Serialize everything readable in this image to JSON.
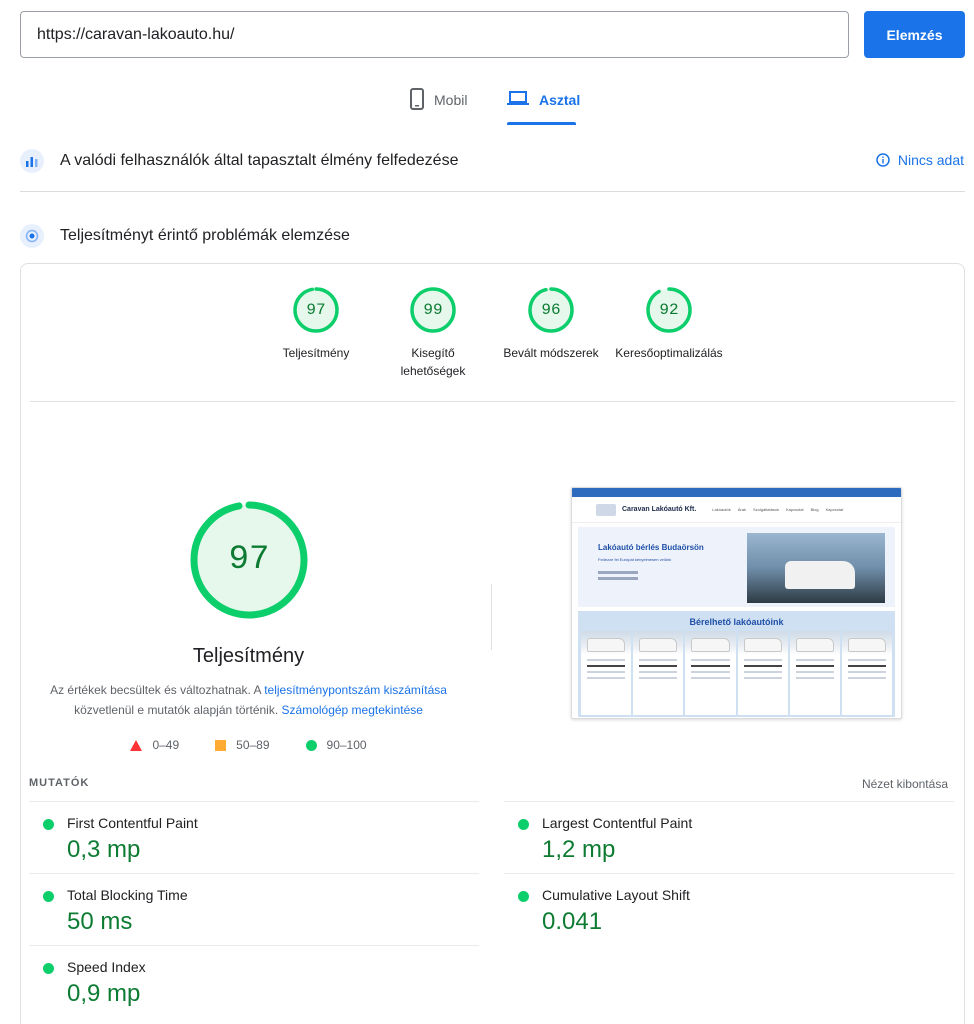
{
  "url_bar": {
    "value": "https://caravan-lakoauto.hu/",
    "button": "Elemzés"
  },
  "tabs": [
    {
      "label": "Mobil",
      "active": false
    },
    {
      "label": "Asztal",
      "active": true
    }
  ],
  "crux": {
    "title": "A valódi felhasználók által tapasztalt élmény felfedezése",
    "status": "Nincs adat"
  },
  "lighthouse": {
    "title": "Teljesítményt érintő problémák elemzése"
  },
  "categories": [
    {
      "score": "97",
      "score_value": 97,
      "label": "Teljesítmény"
    },
    {
      "score": "99",
      "score_value": 99,
      "label_line1": "Kisegítő",
      "label_line2": "lehetőségek"
    },
    {
      "score": "96",
      "score_value": 96,
      "label": "Bevált módszerek"
    },
    {
      "score": "92",
      "score_value": 92,
      "label": "Keresőoptimalizálás"
    }
  ],
  "performance": {
    "score": "97",
    "score_value": 97,
    "title": "Teljesítmény",
    "disclaimer_start": "Az értékek becsültek és változhatnak. A ",
    "disclaimer_link1": "teljesítménypontszám kiszámítása",
    "disclaimer_mid": " közvetlenül e mutatók alapján történik. ",
    "disclaimer_link2": "Számológép megtekintése"
  },
  "legend": [
    {
      "shape": "triangle",
      "label": "0–49",
      "color": "#ff3333"
    },
    {
      "shape": "square",
      "label": "50–89",
      "color": "#ffaa33"
    },
    {
      "shape": "circle",
      "label": "90–100",
      "color": "#0cce6b"
    }
  ],
  "screenshot": {
    "brand": "Caravan Lakóautó Kft.",
    "hero_title": "Lakóautó bérlés Budaörsön",
    "hero_sub": "Fedezze fel Európát kényelmesen velünk",
    "rent_title": "Bérelhető lakóautóink",
    "menu": [
      "Lakóautók",
      "Árak",
      "Szolgáltatások",
      "Kapcsolat",
      "Blog",
      "Kapcsolat"
    ]
  },
  "metrics": {
    "section_label": "MUTATÓK",
    "expand_label": "Nézet kibontása",
    "items": [
      {
        "name": "First Contentful Paint",
        "value": "0,3 mp"
      },
      {
        "name": "Largest Contentful Paint",
        "value": "1,2 mp"
      },
      {
        "name": "Total Blocking Time",
        "value": "50 ms"
      },
      {
        "name": "Cumulative Layout Shift",
        "value": "0.041"
      },
      {
        "name": "Speed Index",
        "value": "0,9 mp"
      }
    ]
  },
  "colors": {
    "accent": "#1a73e8",
    "pass": "#0cce6b",
    "pass_text": "#0d7c32"
  }
}
